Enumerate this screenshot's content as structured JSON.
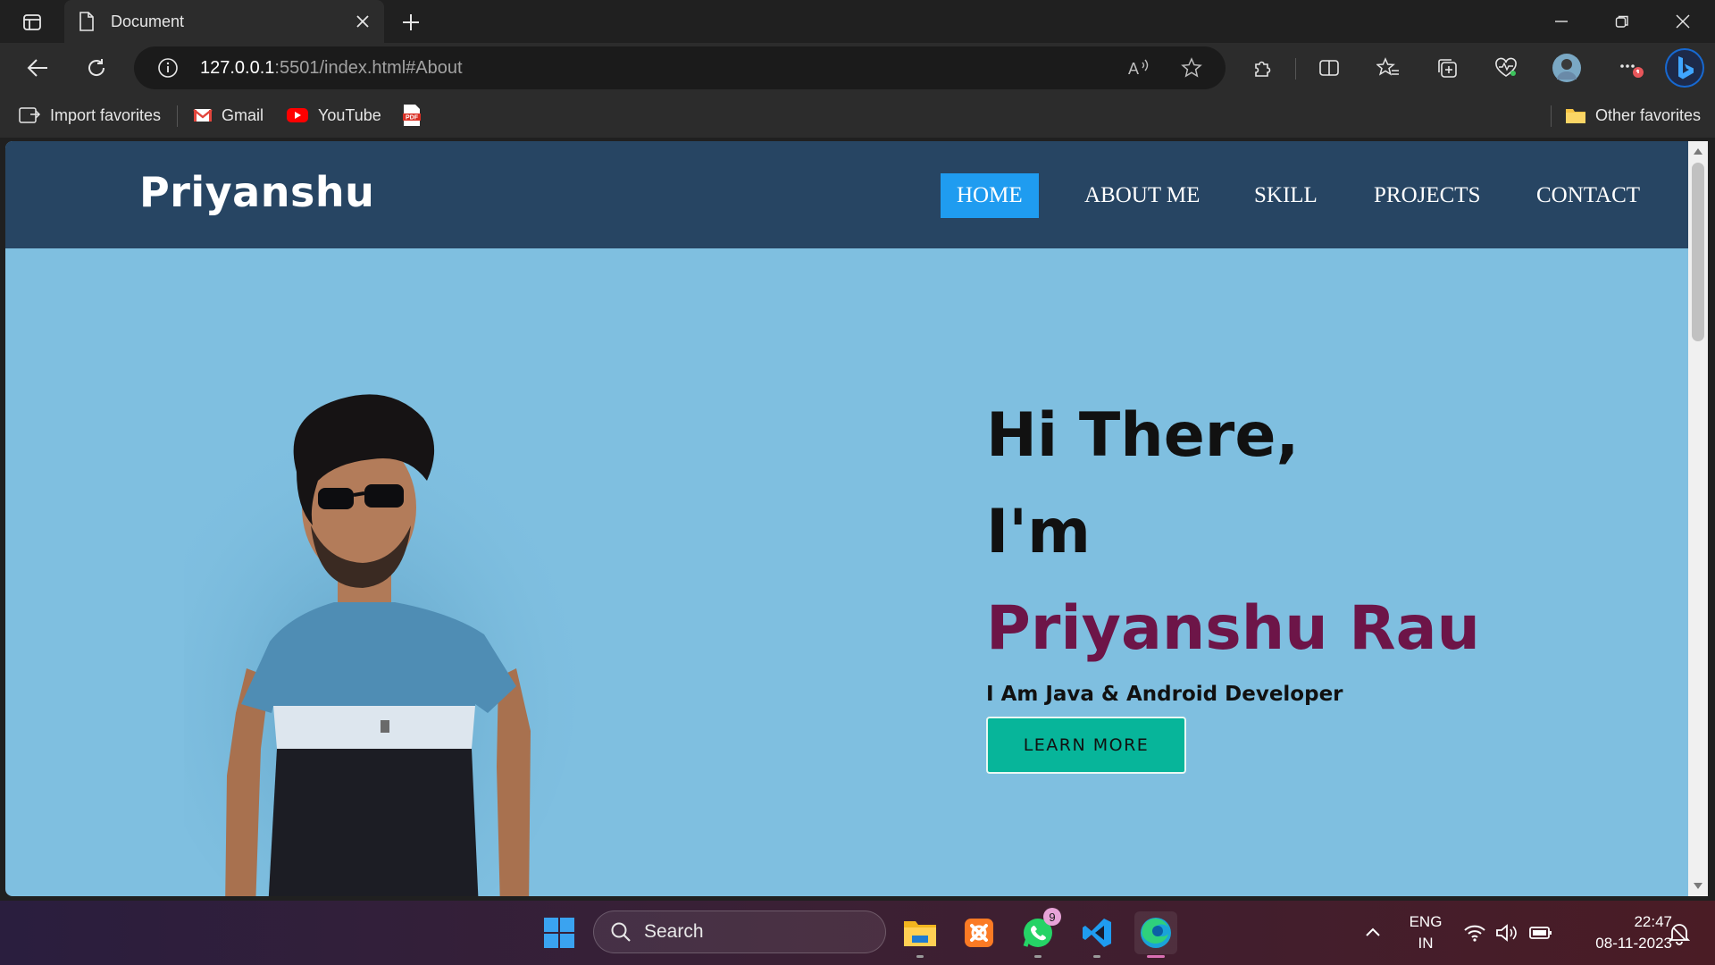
{
  "browser": {
    "tab_title": "Document",
    "url_host": "127.0.0.1",
    "url_rest": ":5501/index.html#About",
    "favorites": {
      "import": "Import favorites",
      "gmail": "Gmail",
      "youtube": "YouTube",
      "pdf_label": "PDF",
      "other": "Other favorites"
    }
  },
  "site": {
    "logo": "Priyanshu",
    "nav": [
      "HOME",
      "ABOUT ME",
      "SKILL",
      "PROJECTS",
      "CONTACT"
    ],
    "active_nav": "HOME",
    "hero": {
      "line1": "Hi There,",
      "line2": "I'm",
      "name": "Priyanshu Rau",
      "role": "I Am Java & Android Developer",
      "cta": "LEARN MORE"
    },
    "colors": {
      "nav_bg": "#274563",
      "hero_bg": "#7fbfe0",
      "active_nav": "#1f9cf0",
      "name": "#6d1548",
      "cta": "#07b59a"
    }
  },
  "taskbar": {
    "search": "Search",
    "whatsapp_badge": "9",
    "lang": "ENG",
    "region": "IN",
    "time": "22:47",
    "date": "08-11-2023"
  }
}
